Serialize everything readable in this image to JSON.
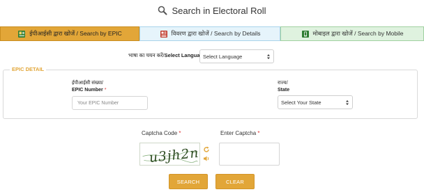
{
  "header": {
    "title": "Search in Electoral Roll",
    "icon": "search-icon"
  },
  "tabs": [
    {
      "label": "ईपीआईसी द्वारा खोजें / Search by EPIC",
      "icon": "id-card-icon",
      "active": true
    },
    {
      "label": "विवरण द्वारा खोजें / Search by Details",
      "icon": "details-form-icon",
      "active": false
    },
    {
      "label": "मोबाइल द्वारा खोजें / Search by Mobile",
      "icon": "mobile-icon",
      "active": false
    }
  ],
  "language": {
    "label_hi": "भाषा का चयन करें/",
    "label_en": "Select Language",
    "selected": "Select Language"
  },
  "epic_detail": {
    "legend": "EPIC DETAIL",
    "epic_label_hi": "ईपीआईसी संख्या/",
    "epic_label_en": "EPIC Number",
    "epic_placeholder": "Your EPIC Number",
    "state_label_hi": "राज्य/",
    "state_label_en": "State",
    "state_selected": "Select Your State"
  },
  "captcha": {
    "code_label": "Captcha Code",
    "enter_label": "Enter Captcha",
    "required_mark": "*",
    "image_text": "u3jh2n"
  },
  "buttons": {
    "search": "SEARCH",
    "clear": "CLEAR"
  },
  "colors": {
    "accent": "#e2a638",
    "tab_details_bg": "#e6f4fb",
    "tab_mobile_bg": "#dff2df",
    "required": "#dd3333"
  }
}
